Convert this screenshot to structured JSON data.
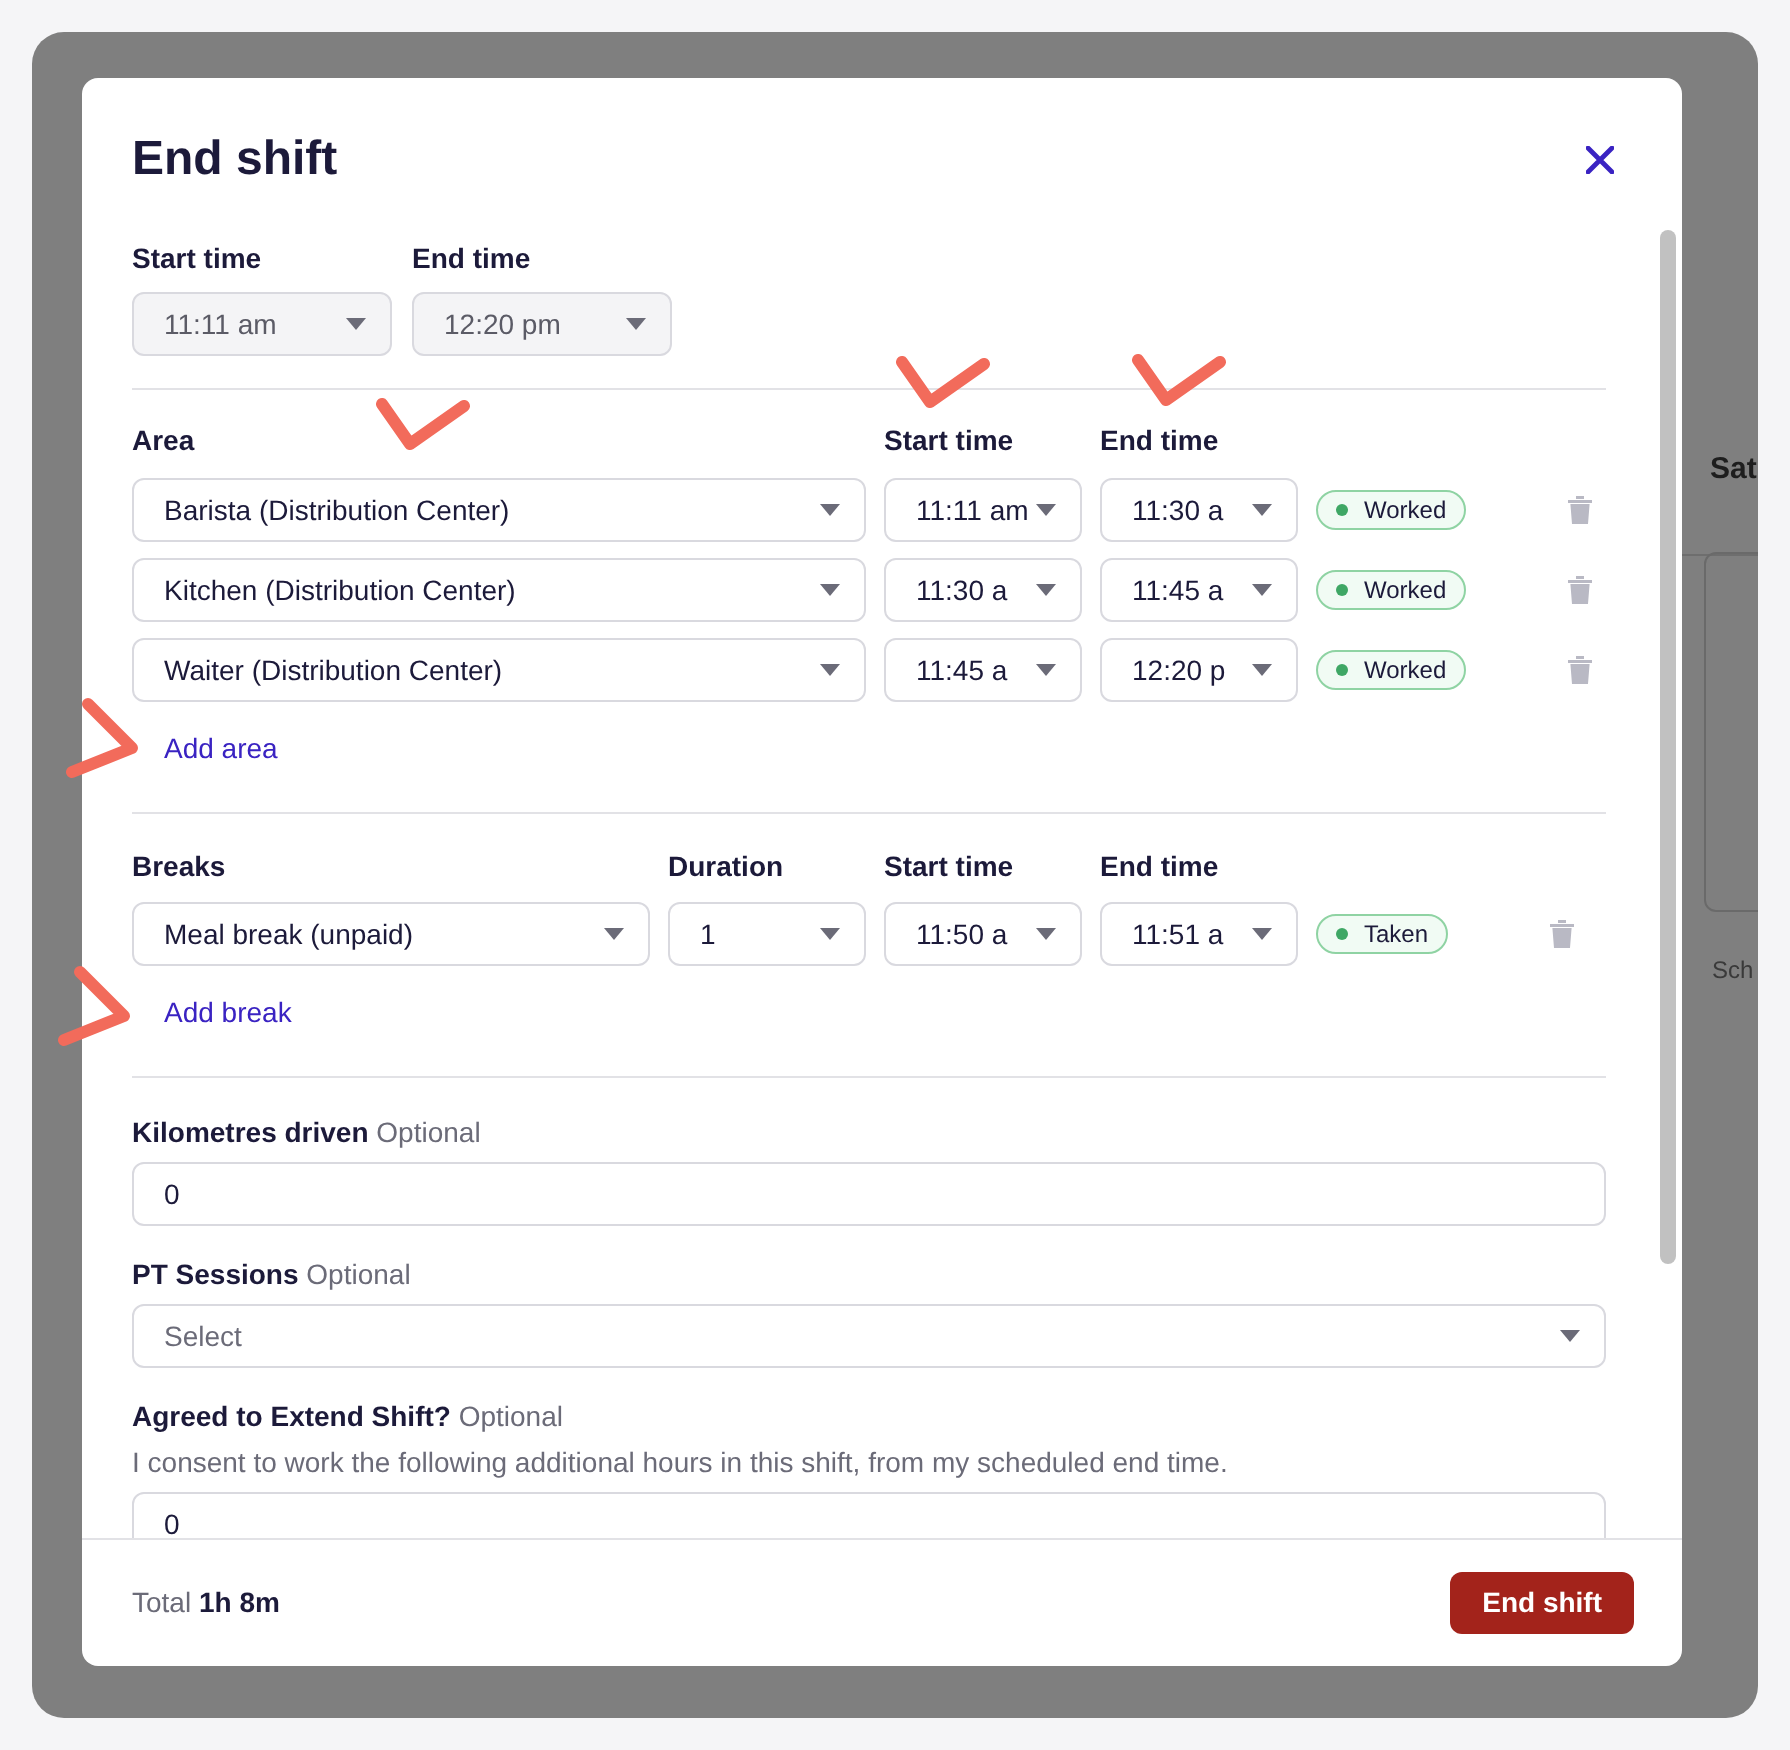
{
  "background": {
    "texts": [
      "Sat",
      "Sch"
    ]
  },
  "modal": {
    "title": "End shift"
  },
  "shift_times": [
    {
      "label": "Start time",
      "value": "11:11 am",
      "disabled": true
    },
    {
      "label": "End time",
      "value": "12:20 pm",
      "disabled": true
    }
  ],
  "areas": {
    "columns": [
      "Area",
      "Start time",
      "End time"
    ],
    "rows": [
      {
        "area": "Barista (Distribution Center)",
        "start": "11:11 am",
        "end": "11:30 a",
        "status": "Worked"
      },
      {
        "area": "Kitchen (Distribution Center)",
        "start": "11:30 a",
        "end": "11:45 a",
        "status": "Worked"
      },
      {
        "area": "Waiter (Distribution Center)",
        "start": "11:45 a",
        "end": "12:20 p",
        "status": "Worked"
      }
    ],
    "add_link": "Add area"
  },
  "breaks": {
    "columns": [
      "Breaks",
      "Duration",
      "Start time",
      "End time"
    ],
    "rows": [
      {
        "type": "Meal break (unpaid)",
        "duration": "1",
        "start": "11:50 a",
        "end": "11:51 a",
        "status": "Taken"
      }
    ],
    "add_link": "Add break"
  },
  "fields": [
    {
      "kind": "text",
      "label": "Kilometres driven",
      "hint": "Optional",
      "value": "0"
    },
    {
      "kind": "select",
      "label": "PT Sessions",
      "hint": "Optional",
      "placeholder": "Select"
    },
    {
      "kind": "text",
      "label": "Agreed to Extend Shift?",
      "hint": "Optional",
      "description": "I consent to work the following additional hours in this shift, from my scheduled end time.",
      "value": "0"
    }
  ],
  "footer": {
    "total_label": "Total",
    "total_value": "1h 8m",
    "button": "End shift"
  }
}
